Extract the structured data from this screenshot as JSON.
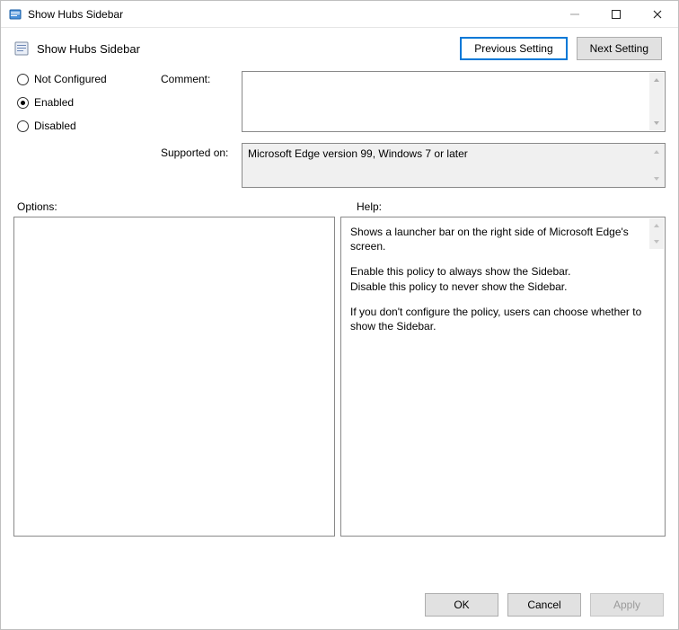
{
  "window": {
    "title": "Show Hubs Sidebar"
  },
  "policy": {
    "title": "Show Hubs Sidebar"
  },
  "nav": {
    "prev": "Previous Setting",
    "next": "Next Setting"
  },
  "state": {
    "options": [
      "Not Configured",
      "Enabled",
      "Disabled"
    ],
    "selected_index": 1
  },
  "labels": {
    "comment": "Comment:",
    "supported": "Supported on:",
    "options": "Options:",
    "help": "Help:"
  },
  "comment": "",
  "supported_on": "Microsoft Edge version 99, Windows 7 or later",
  "help": {
    "p1": "Shows a launcher bar on the right side of Microsoft Edge's screen.",
    "p2a": "Enable this policy to always show the Sidebar.",
    "p2b": "Disable this policy to never show the Sidebar.",
    "p3": "If you don't configure the policy, users can choose whether to show the Sidebar."
  },
  "footer": {
    "ok": "OK",
    "cancel": "Cancel",
    "apply": "Apply"
  }
}
